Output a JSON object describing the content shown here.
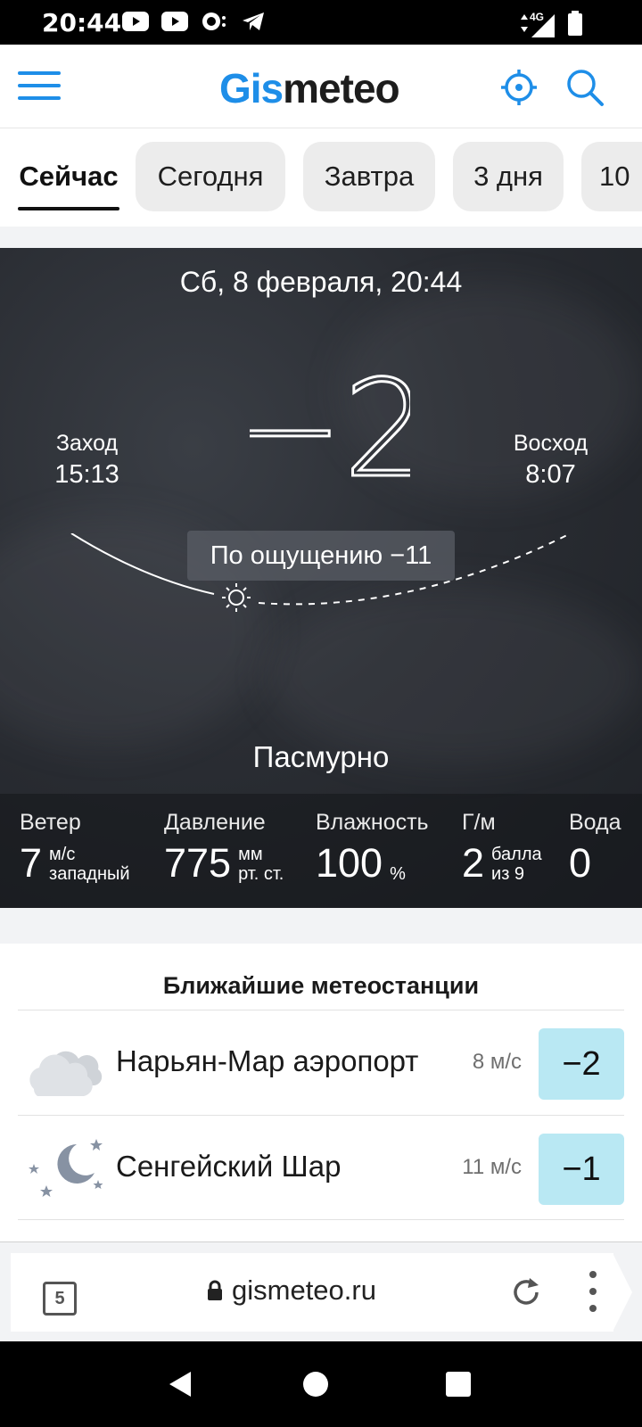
{
  "status_bar": {
    "time": "20:44",
    "network": "4G",
    "icons": [
      "youtube-icon",
      "youtube-icon",
      "messenger-icon",
      "telegram-icon",
      "signal-icon",
      "battery-icon"
    ]
  },
  "header": {
    "logo_part1": "Gis",
    "logo_part2": "meteo",
    "accent_color": "#1e8ee8"
  },
  "tabs": [
    {
      "label": "Сейчас",
      "active": true
    },
    {
      "label": "Сегодня",
      "active": false
    },
    {
      "label": "Завтра",
      "active": false
    },
    {
      "label": "3 дня",
      "active": false
    },
    {
      "label": "10",
      "active": false
    }
  ],
  "weather": {
    "date": "Сб, 8 февраля, 20:44",
    "temperature": "−2",
    "sunset_label": "Заход",
    "sunset_time": "15:13",
    "sunrise_label": "Восход",
    "sunrise_time": "8:07",
    "feels_like": "По ощущению −11",
    "condition": "Пасмурно",
    "stats": [
      {
        "label": "Ветер",
        "value": "7",
        "unit1": "м/с",
        "unit2": "западный"
      },
      {
        "label": "Давление",
        "value": "775",
        "unit1": "мм",
        "unit2": "рт. ст."
      },
      {
        "label": "Влажность",
        "value": "100",
        "unit1": "",
        "unit2": "%"
      },
      {
        "label": "Г/м",
        "value": "2",
        "unit1": "балла",
        "unit2": "из 9"
      },
      {
        "label": "Вода",
        "value": "0",
        "unit1": "",
        "unit2": ""
      }
    ]
  },
  "stations": {
    "title": "Ближайшие метеостанции",
    "items": [
      {
        "name": "Нарьян-Мар аэропорт",
        "wind": "8 м/с",
        "temp": "−2",
        "icon": "cloudy-icon"
      },
      {
        "name": "Сенгейский Шар",
        "wind": "11 м/с",
        "temp": "−1",
        "icon": "night-clear-icon"
      }
    ],
    "temp_badge_color": "#b9e8f3"
  },
  "browser": {
    "tab_count": "5",
    "url": "gismeteo.ru"
  }
}
